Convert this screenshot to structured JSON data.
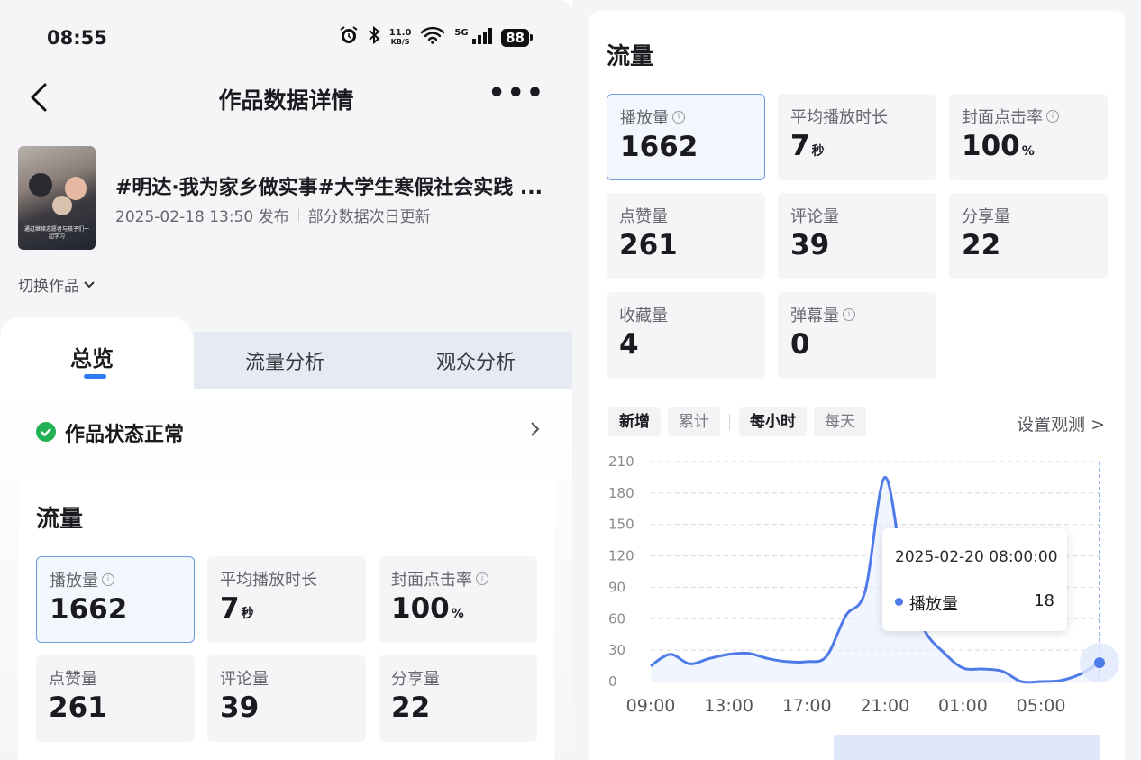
{
  "status_bar": {
    "time": "08:55",
    "net_speed_top": "11.0",
    "net_speed_bottom": "KB/S",
    "signal_label": "5G",
    "battery": "88"
  },
  "header": {
    "title": "作品数据详情"
  },
  "work": {
    "title": "#明达·我为家乡做实事#大学生寒假社会实践 ...",
    "published": "2025-02-18 13:50 发布",
    "note": "部分数据次日更新",
    "thumb_caption": "通过继续志愿者与孩子们一起学习",
    "switch_label": "切换作品"
  },
  "tabs": [
    {
      "label": "总览",
      "active": true
    },
    {
      "label": "流量分析",
      "active": false
    },
    {
      "label": "观众分析",
      "active": false
    }
  ],
  "status_row": {
    "label": "作品状态正常"
  },
  "traffic": {
    "title": "流量",
    "metrics": [
      {
        "name": "播放量",
        "value": "1662",
        "unit": "",
        "info": true,
        "selected": true
      },
      {
        "name": "平均播放时长",
        "value": "7",
        "unit": "秒",
        "info": false,
        "selected": false
      },
      {
        "name": "封面点击率",
        "value": "100",
        "unit": "%",
        "info": true,
        "selected": false
      },
      {
        "name": "点赞量",
        "value": "261",
        "unit": "",
        "info": false,
        "selected": false
      },
      {
        "name": "评论量",
        "value": "39",
        "unit": "",
        "info": false,
        "selected": false
      },
      {
        "name": "分享量",
        "value": "22",
        "unit": "",
        "info": false,
        "selected": false
      },
      {
        "name": "收藏量",
        "value": "4",
        "unit": "",
        "info": false,
        "selected": false
      },
      {
        "name": "弹幕量",
        "value": "0",
        "unit": "",
        "info": true,
        "selected": false
      }
    ]
  },
  "chart_controls": {
    "mode_chips": [
      "新增",
      "累计"
    ],
    "mode_selected": "新增",
    "interval_chips": [
      "每小时",
      "每天"
    ],
    "interval_selected": "每小时",
    "settings_link": "设置观测 >"
  },
  "tooltip": {
    "datetime": "2025-02-20 08:00:00",
    "series": "播放量",
    "value": "18"
  },
  "chart_data": {
    "type": "line",
    "title": "",
    "xlabel": "",
    "ylabel": "",
    "series_color": "#4e7be8",
    "x_tick_labels": [
      "09:00",
      "13:00",
      "17:00",
      "21:00",
      "01:00",
      "05:00"
    ],
    "y_ticks": [
      0,
      30,
      60,
      90,
      120,
      150,
      180,
      210
    ],
    "ylim": [
      0,
      210
    ],
    "grid": true,
    "series": [
      {
        "name": "播放量",
        "x": [
          "09:00",
          "10:00",
          "11:00",
          "12:00",
          "13:00",
          "14:00",
          "15:00",
          "16:00",
          "17:00",
          "18:00",
          "19:00",
          "20:00",
          "21:00",
          "22:00",
          "23:00",
          "00:00",
          "01:00",
          "02:00",
          "03:00",
          "04:00",
          "05:00",
          "06:00",
          "07:00",
          "08:00"
        ],
        "values": [
          15,
          26,
          17,
          22,
          26,
          27,
          22,
          19,
          19,
          24,
          63,
          87,
          195,
          100,
          50,
          28,
          13,
          12,
          10,
          0,
          0,
          1,
          7,
          18
        ]
      }
    ]
  }
}
